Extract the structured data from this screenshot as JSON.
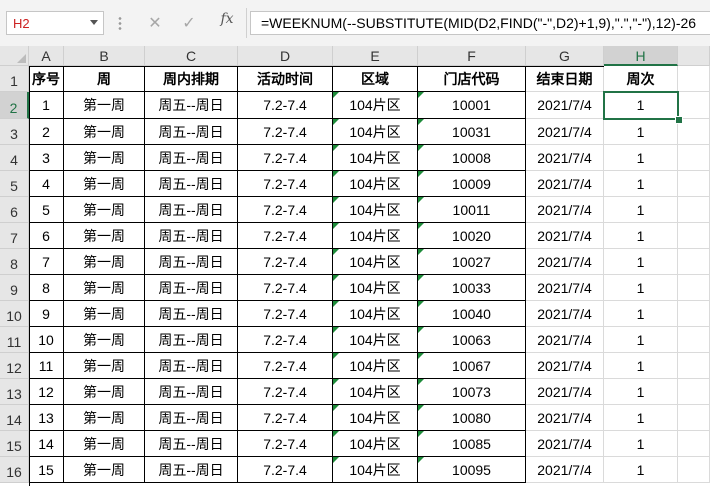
{
  "formula_bar": {
    "name_box": "H2",
    "cancel_icon": "✕",
    "enter_icon": "✓",
    "fx_label": "fx",
    "formula": "=WEEKNUM(--SUBSTITUTE(MID(D2,FIND(\"-\",D2)+1,9),\".\",\"-\"),12)-26"
  },
  "sheet": {
    "column_letters": [
      "A",
      "B",
      "C",
      "D",
      "E",
      "F",
      "G",
      "H"
    ],
    "row_numbers": [
      "1",
      "2",
      "3",
      "4",
      "5",
      "6",
      "7",
      "8",
      "9",
      "10",
      "11",
      "12",
      "13",
      "14",
      "15",
      "16"
    ],
    "selected_cell": "H2",
    "headers": [
      "序号",
      "周",
      "周内排期",
      "活动时间",
      "区域",
      "门店代码",
      "结束日期",
      "周次"
    ],
    "rows": [
      [
        "1",
        "第一周",
        "周五--周日",
        "7.2-7.4",
        "104片区",
        "10001",
        "2021/7/4",
        "1"
      ],
      [
        "2",
        "第一周",
        "周五--周日",
        "7.2-7.4",
        "104片区",
        "10031",
        "2021/7/4",
        "1"
      ],
      [
        "3",
        "第一周",
        "周五--周日",
        "7.2-7.4",
        "104片区",
        "10008",
        "2021/7/4",
        "1"
      ],
      [
        "4",
        "第一周",
        "周五--周日",
        "7.2-7.4",
        "104片区",
        "10009",
        "2021/7/4",
        "1"
      ],
      [
        "5",
        "第一周",
        "周五--周日",
        "7.2-7.4",
        "104片区",
        "10011",
        "2021/7/4",
        "1"
      ],
      [
        "6",
        "第一周",
        "周五--周日",
        "7.2-7.4",
        "104片区",
        "10020",
        "2021/7/4",
        "1"
      ],
      [
        "7",
        "第一周",
        "周五--周日",
        "7.2-7.4",
        "104片区",
        "10027",
        "2021/7/4",
        "1"
      ],
      [
        "8",
        "第一周",
        "周五--周日",
        "7.2-7.4",
        "104片区",
        "10033",
        "2021/7/4",
        "1"
      ],
      [
        "9",
        "第一周",
        "周五--周日",
        "7.2-7.4",
        "104片区",
        "10040",
        "2021/7/4",
        "1"
      ],
      [
        "10",
        "第一周",
        "周五--周日",
        "7.2-7.4",
        "104片区",
        "10063",
        "2021/7/4",
        "1"
      ],
      [
        "11",
        "第一周",
        "周五--周日",
        "7.2-7.4",
        "104片区",
        "10067",
        "2021/7/4",
        "1"
      ],
      [
        "12",
        "第一周",
        "周五--周日",
        "7.2-7.4",
        "104片区",
        "10073",
        "2021/7/4",
        "1"
      ],
      [
        "13",
        "第一周",
        "周五--周日",
        "7.2-7.4",
        "104片区",
        "10080",
        "2021/7/4",
        "1"
      ],
      [
        "14",
        "第一周",
        "周五--周日",
        "7.2-7.4",
        "104片区",
        "10085",
        "2021/7/4",
        "1"
      ],
      [
        "15",
        "第一周",
        "周五--周日",
        "7.2-7.4",
        "104片区",
        "10095",
        "2021/7/4",
        "1"
      ]
    ]
  },
  "colors": {
    "selection": "#217346",
    "error_indicator": "#1e8c3a",
    "name_box_text": "#cc2222"
  }
}
